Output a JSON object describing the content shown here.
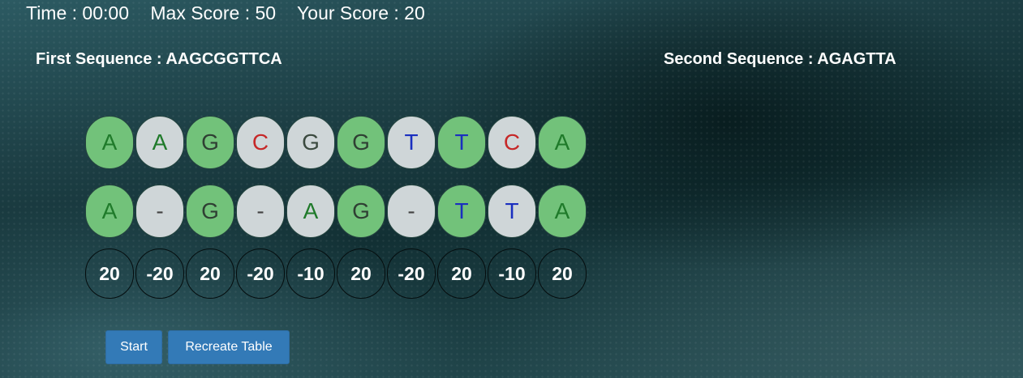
{
  "stats": {
    "time": "Time : 00:00",
    "max_score": "Max Score : 50",
    "your_score": "Your Score : 20"
  },
  "sequences": {
    "first": "First Sequence : AAGCGGTTCA",
    "second": "Second Sequence : AGAGTTA"
  },
  "alignment": {
    "top_row": [
      {
        "base": "A",
        "match": true
      },
      {
        "base": "A",
        "match": false
      },
      {
        "base": "G",
        "match": true
      },
      {
        "base": "C",
        "match": false
      },
      {
        "base": "G",
        "match": false
      },
      {
        "base": "G",
        "match": true
      },
      {
        "base": "T",
        "match": false
      },
      {
        "base": "T",
        "match": true
      },
      {
        "base": "C",
        "match": false
      },
      {
        "base": "A",
        "match": true
      }
    ],
    "bottom_row": [
      {
        "base": "A",
        "match": true
      },
      {
        "base": "-",
        "match": false
      },
      {
        "base": "G",
        "match": true
      },
      {
        "base": "-",
        "match": false
      },
      {
        "base": "A",
        "match": false
      },
      {
        "base": "G",
        "match": true
      },
      {
        "base": "-",
        "match": false
      },
      {
        "base": "T",
        "match": true
      },
      {
        "base": "T",
        "match": false
      },
      {
        "base": "A",
        "match": true
      }
    ],
    "scores": [
      "20",
      "-20",
      "20",
      "-20",
      "-10",
      "20",
      "-20",
      "20",
      "-10",
      "20"
    ]
  },
  "buttons": {
    "start": "Start",
    "recreate": "Recreate Table"
  },
  "colors": {
    "match_cell": "#72c27a",
    "mismatch_cell": "#cfd6d8",
    "base_A": "#1f7a2a",
    "base_C": "#c62828",
    "base_T": "#1a2fbf",
    "button": "#337ab7"
  }
}
